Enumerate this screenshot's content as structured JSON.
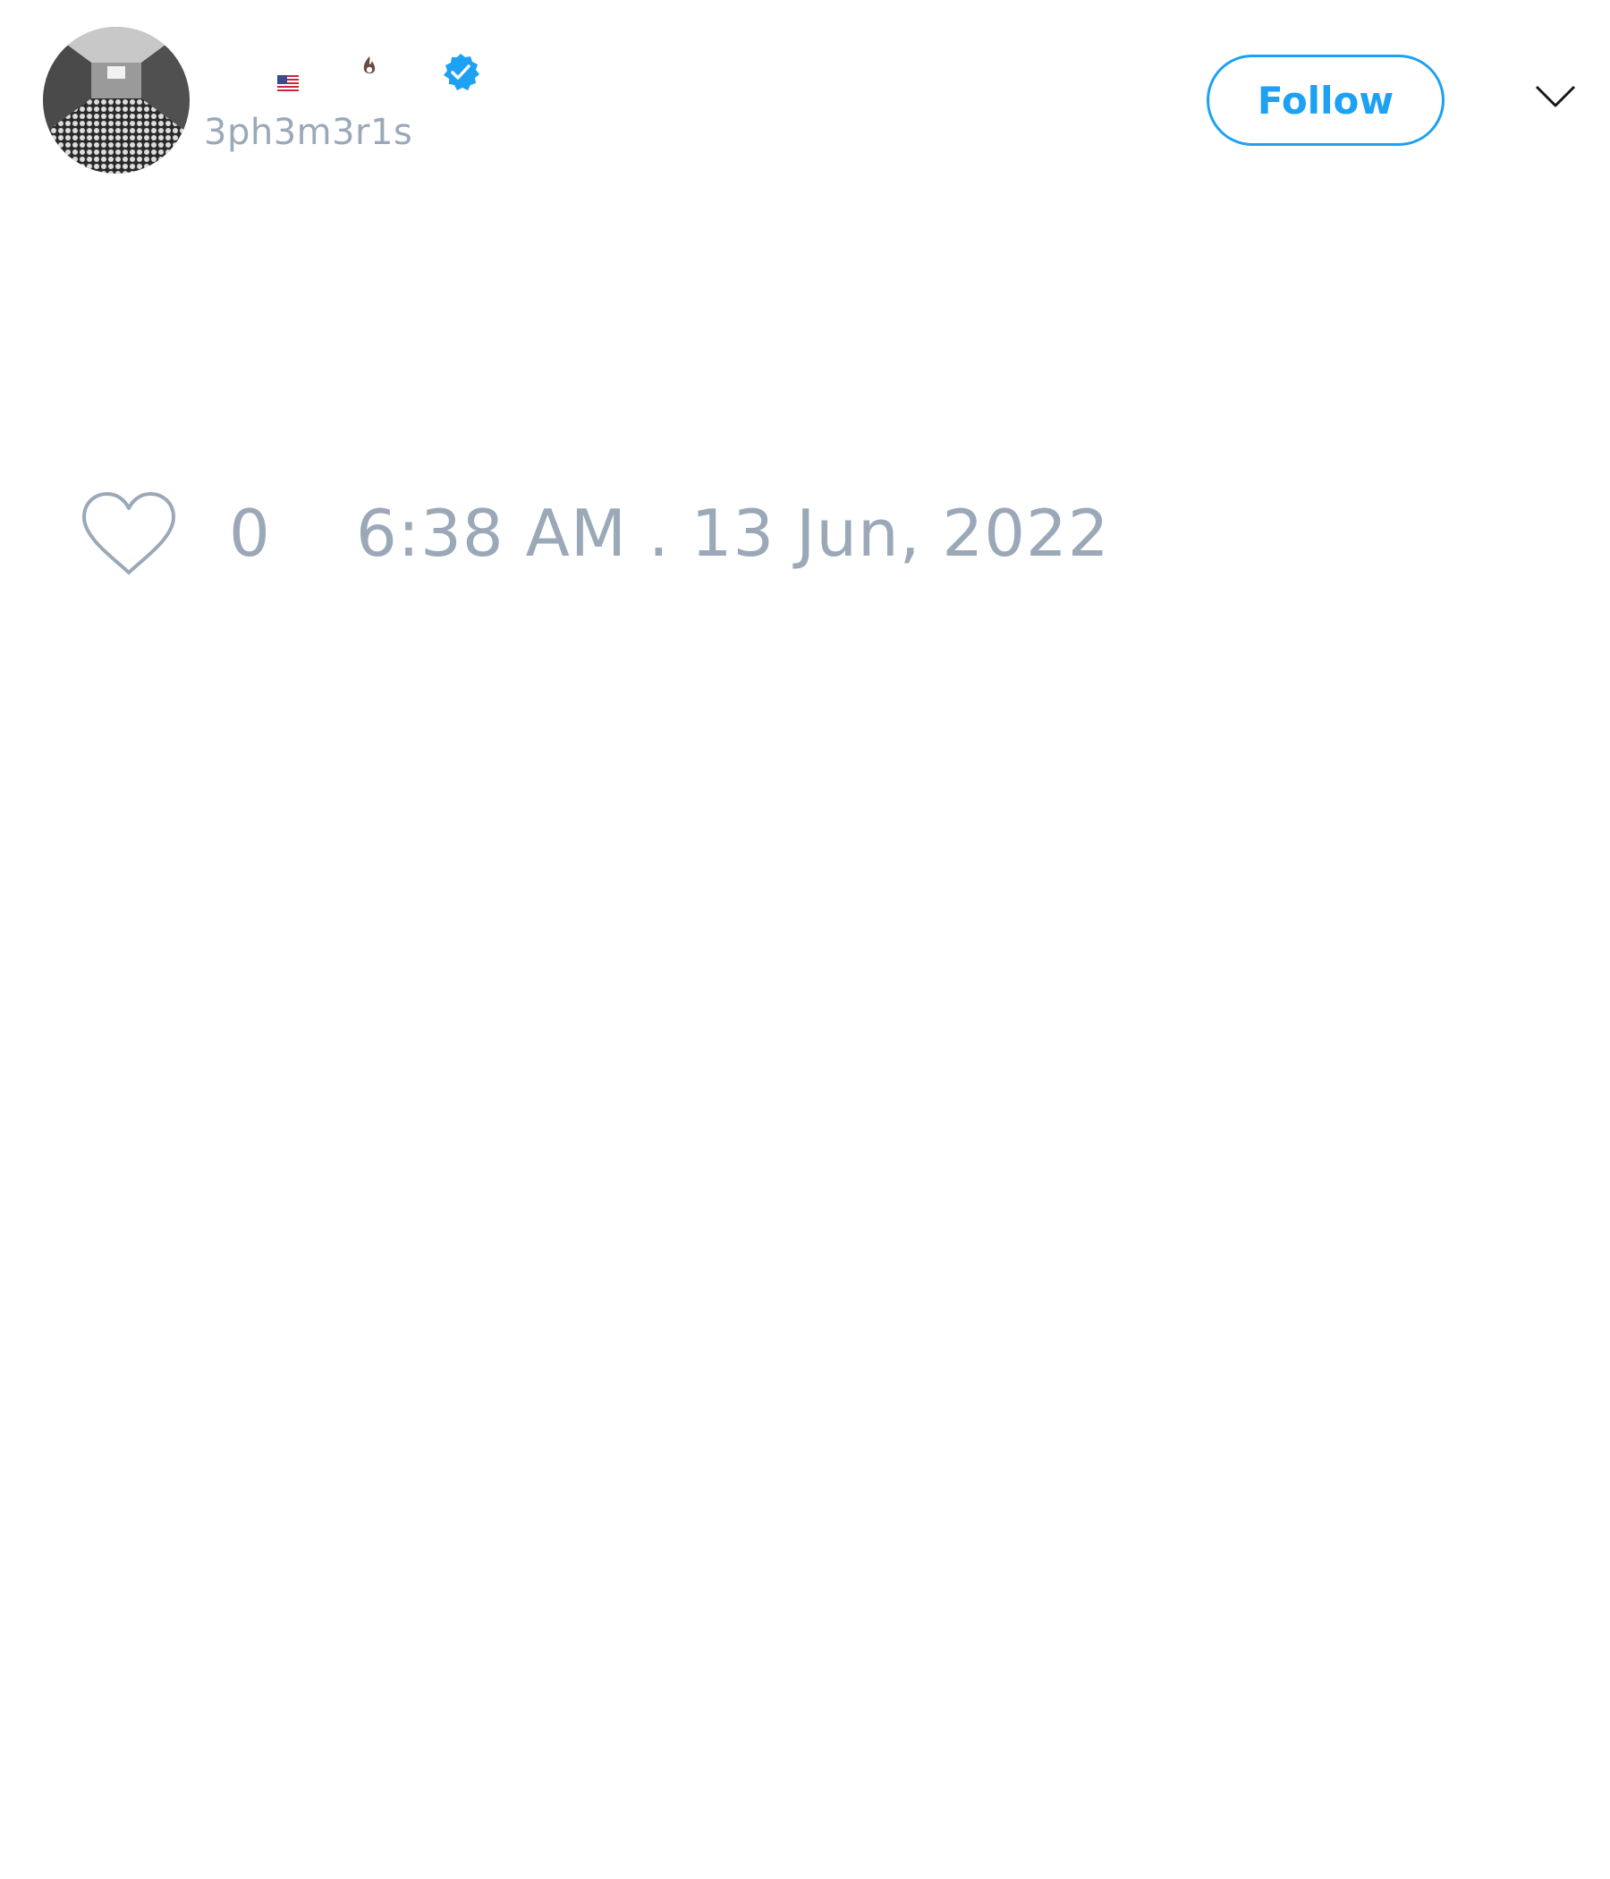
{
  "author": {
    "handle": "3ph3m3r1s",
    "avatar_icon": "corridor-photo-avatar",
    "name_emoji": [
      "us-flag-icon",
      "flame-icon"
    ],
    "verified": true
  },
  "actions": {
    "follow_label": "Follow",
    "menu_icon": "chevron-down-icon"
  },
  "tweet": {
    "like_count": "0",
    "timestamp": "6:38 AM . 13 Jun, 2022"
  },
  "colors": {
    "accent": "#1da1f2",
    "muted_text": "#9aa8b8",
    "background": "#ffffff"
  }
}
